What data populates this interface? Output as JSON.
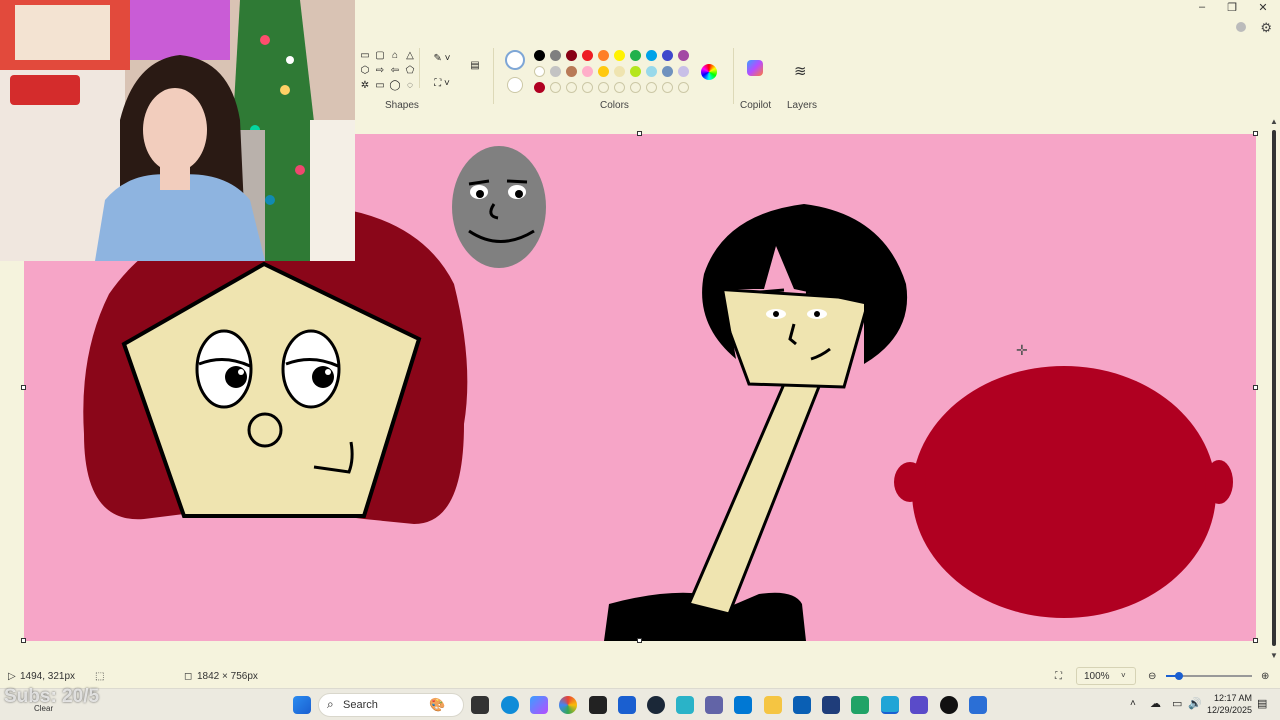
{
  "window": {
    "minimize": "–",
    "restore": "❐",
    "close": "✕"
  },
  "ribbon": {
    "groups": {
      "shapes": "Shapes",
      "colors": "Colors",
      "copilot": "Copilot",
      "layers": "Layers"
    },
    "palette_row1": [
      "#000000",
      "#7f7f7f",
      "#880015",
      "#ed1c24",
      "#ff7f27",
      "#fff200",
      "#22b14c",
      "#00a2e8",
      "#3f48cc",
      "#a349a4"
    ],
    "palette_row2": [
      "#ffffff",
      "#c3c3c3",
      "#b97a57",
      "#ffaec9",
      "#ffc90e",
      "#efe4b0",
      "#b5e61d",
      "#99d9ea",
      "#7092be",
      "#c8bfe7"
    ],
    "palette_row3": [
      "#b00021",
      "",
      "",
      "",
      "",
      "",
      "",
      "",
      "",
      ""
    ]
  },
  "canvas": {
    "background": "#f6a5c7"
  },
  "status": {
    "cursor_pos": "1494, 321px",
    "canvas_size": "1842 × 756px",
    "zoom": "100%",
    "zoom_fraction": 0.15
  },
  "taskbar": {
    "search_label": "Search",
    "time": "12:17 AM",
    "date": "12/29/2025"
  },
  "overlay": {
    "subs": "Subs: 20/5",
    "clear": "Clear"
  }
}
